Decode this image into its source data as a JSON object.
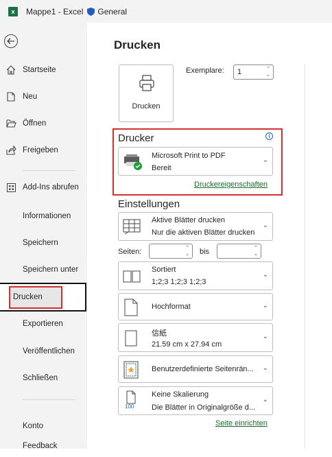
{
  "titlebar": {
    "app_icon": "excel-icon",
    "app_icon_letter": "x",
    "title": "Mappe1 - Excel",
    "sensitivity": "General"
  },
  "sidebar": {
    "items": [
      {
        "label": "Startseite",
        "icon": "home-icon"
      },
      {
        "label": "Neu",
        "icon": "new-document-icon"
      },
      {
        "label": "Öffnen",
        "icon": "open-folder-icon"
      },
      {
        "label": "Freigeben",
        "icon": "share-icon"
      },
      {
        "label": "Add-Ins abrufen",
        "icon": "add-ins-icon"
      },
      {
        "label": "Informationen"
      },
      {
        "label": "Speichern"
      },
      {
        "label": "Speichern unter"
      },
      {
        "label": "Drucken"
      },
      {
        "label": "Exportieren"
      },
      {
        "label": "Veröffentlichen"
      },
      {
        "label": "Schließen"
      },
      {
        "label": "Konto"
      },
      {
        "label": "Feedback"
      }
    ],
    "active": "Drucken"
  },
  "print": {
    "heading": "Drucken",
    "print_button_label": "Drucken",
    "copies_label": "Exemplare:",
    "copies_value": "1",
    "printer_section": "Drucker",
    "printer_name": "Microsoft Print to PDF",
    "printer_status": "Bereit",
    "printer_properties_link": "Druckereigenschaften",
    "settings_section": "Einstellungen",
    "settings": {
      "what": {
        "line1": "Aktive Blätter drucken",
        "line2": "Nur die aktiven Blätter drucken"
      },
      "pages_label": "Seiten:",
      "pages_to_label": "bis",
      "collate": {
        "line1": "Sortiert",
        "line2": "1;2;3    1;2;3    1;2;3"
      },
      "orientation": {
        "line1": "Hochformat"
      },
      "paper": {
        "line1": "信紙",
        "line2": "21.59 cm x 27.94 cm"
      },
      "margins": {
        "line1": "Benutzerdefinierte Seitenrän..."
      },
      "scaling": {
        "line1": "Keine Skalierung",
        "line2": "Die Blätter in Originalgröße d...",
        "icon_text": "100"
      }
    },
    "page_setup_link": "Seite einrichten"
  }
}
